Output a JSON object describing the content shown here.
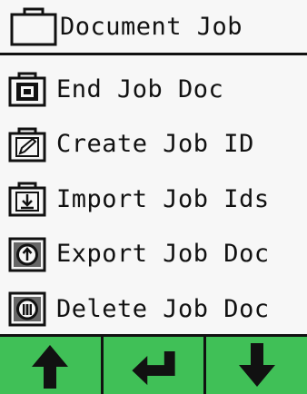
{
  "header": {
    "title": "Document Job",
    "icon": "briefcase-icon"
  },
  "menu": {
    "items": [
      {
        "label": "End Job Doc",
        "icon": "briefcase-stop-icon"
      },
      {
        "label": "Create Job ID",
        "icon": "briefcase-edit-icon"
      },
      {
        "label": "Import Job Ids",
        "icon": "briefcase-import-icon"
      },
      {
        "label": "Export Job Doc",
        "icon": "export-disc-icon"
      },
      {
        "label": "Delete Job Doc",
        "icon": "delete-disc-icon"
      }
    ]
  },
  "footer": {
    "buttons": [
      {
        "icon": "arrow-up-icon"
      },
      {
        "icon": "enter-icon"
      },
      {
        "icon": "arrow-down-icon"
      }
    ],
    "background": "#40c057"
  }
}
